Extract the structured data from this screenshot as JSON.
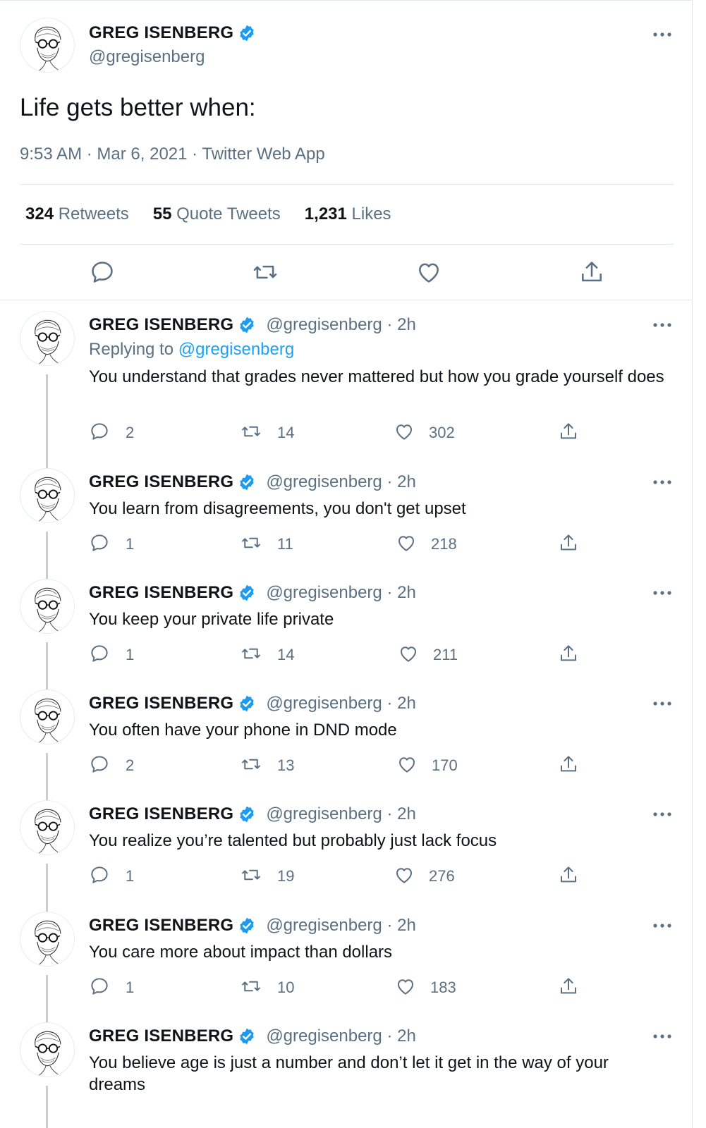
{
  "main_tweet": {
    "author_name": "GREG ISENBERG",
    "author_handle": "@gregisenberg",
    "text": "Life gets better when:",
    "time": "9:53 AM",
    "date": "Mar 6, 2021",
    "source": "Twitter Web App",
    "stats": {
      "retweets_count": "324",
      "retweets_label": "Retweets",
      "quotes_count": "55",
      "quotes_label": "Quote Tweets",
      "likes_count": "1,231",
      "likes_label": "Likes"
    }
  },
  "replies": [
    {
      "name": "GREG ISENBERG",
      "handle": "@gregisenberg",
      "time": "2h",
      "replying_prefix": "Replying to ",
      "replying_to": "@gregisenberg",
      "text": "You understand that grades never mattered but how you grade yourself does",
      "replies": "2",
      "retweets": "14",
      "likes": "302"
    },
    {
      "name": "GREG ISENBERG",
      "handle": "@gregisenberg",
      "time": "2h",
      "text": "You learn from disagreements, you don't get upset",
      "replies": "1",
      "retweets": "11",
      "likes": "218"
    },
    {
      "name": "GREG ISENBERG",
      "handle": "@gregisenberg",
      "time": "2h",
      "text": "You keep your private life private",
      "replies": "1",
      "retweets": "14",
      "likes": "211"
    },
    {
      "name": "GREG ISENBERG",
      "handle": "@gregisenberg",
      "time": "2h",
      "text": "You often have your phone in DND mode",
      "replies": "2",
      "retweets": "13",
      "likes": "170"
    },
    {
      "name": "GREG ISENBERG",
      "handle": "@gregisenberg",
      "time": "2h",
      "text": "You realize you’re talented but probably just lack focus",
      "replies": "1",
      "retweets": "19",
      "likes": "276"
    },
    {
      "name": "GREG ISENBERG",
      "handle": "@gregisenberg",
      "time": "2h",
      "text": "You care more about impact than dollars",
      "replies": "1",
      "retweets": "10",
      "likes": "183"
    },
    {
      "name": "GREG ISENBERG",
      "handle": "@gregisenberg",
      "time": "2h",
      "text": "You believe age is just a number and don’t let it get in the way of your dreams"
    }
  ],
  "colors": {
    "verified": "#1d9bf0",
    "link": "#1da1f2",
    "secondary_text": "#5b7083",
    "thread_line": "#c4cfd6"
  },
  "icons": {
    "reply": "speech-bubble-icon",
    "retweet": "retweet-arrows-icon",
    "like": "heart-icon",
    "share": "share-upload-icon",
    "more": "ellipsis-icon",
    "verified": "verified-badge-icon"
  }
}
